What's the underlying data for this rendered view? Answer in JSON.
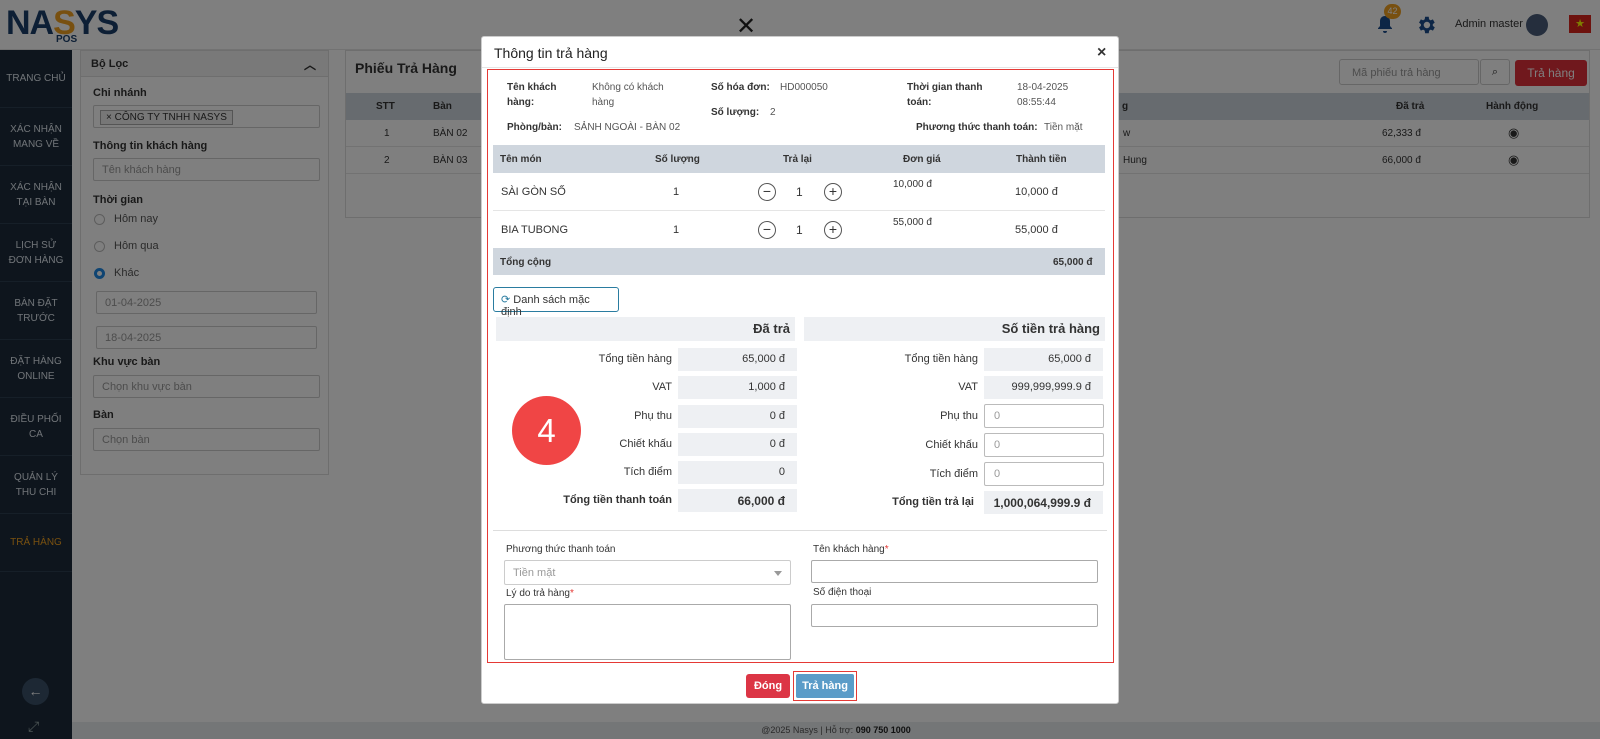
{
  "app": {
    "logo_text_1": "NA",
    "logo_text_2": "S",
    "logo_text_3": "YS",
    "logo_sub": "POS",
    "notification_count": "42",
    "user_name": "Admin master",
    "flag_icon": "vietnam-flag-icon"
  },
  "sidebar": {
    "items": [
      {
        "label": "TRANG CHỦ"
      },
      {
        "label": "XÁC NHẬN MANG VỀ"
      },
      {
        "label": "XÁC NHẬN TẠI BÀN"
      },
      {
        "label": "LỊCH SỬ ĐƠN HÀNG"
      },
      {
        "label": "BÀN ĐẶT TRƯỚC"
      },
      {
        "label": "ĐẶT HÀNG ONLINE"
      },
      {
        "label": "ĐIỀU PHỐI CA"
      },
      {
        "label": "QUẢN LÝ THU CHI"
      },
      {
        "label": "TRẢ HÀNG"
      }
    ]
  },
  "filter": {
    "title": "Bộ Lọc",
    "branch_label": "Chi nhánh",
    "branch_chip": "CÔNG TY TNHH NASYS",
    "customer_label": "Thông tin khách hàng",
    "customer_placeholder": "Tên khách hàng",
    "time_label": "Thời gian",
    "radio_today": "Hôm nay",
    "radio_yesterday": "Hôm qua",
    "radio_other": "Khác",
    "date_from": "01-04-2025",
    "date_to": "18-04-2025",
    "area_label": "Khu vực bàn",
    "area_placeholder": "Chọn khu vực bàn",
    "table_label": "Bàn",
    "table_placeholder": "Chọn bàn"
  },
  "list": {
    "title": "Phiếu Trả Hàng",
    "search_placeholder": "Mã phiếu trả hàng",
    "add_button": "Trả hàng",
    "headers": {
      "stt": "STT",
      "ban": "Bàn",
      "g": "g",
      "da_tra": "Đã trả",
      "hanh_dong": "Hành động"
    },
    "rows": [
      {
        "stt": "1",
        "ban": "BÀN 02",
        "name": "w",
        "da_tra": "62,333 đ"
      },
      {
        "stt": "2",
        "ban": "BÀN 03",
        "name": "Hung",
        "da_tra": "66,000 đ"
      }
    ]
  },
  "modal": {
    "title": "Thông tin trả hàng",
    "info": {
      "customer_label": "Tên khách hàng:",
      "customer_value": "Không có khách hàng",
      "invoice_label": "Số hóa đơn:",
      "invoice_value": "HD000050",
      "time_label": "Thời gian thanh toán:",
      "time_value_1": "18-04-2025",
      "time_value_2": "08:55:44",
      "qty_label": "Số lượng:",
      "qty_value": "2",
      "room_label": "Phòng/bàn:",
      "room_value": "SẢNH NGOÀI - BÀN 02",
      "payment_label": "Phương thức thanh toán:",
      "payment_value": "Tiền mặt"
    },
    "items_headers": {
      "name": "Tên món",
      "qty": "Số lượng",
      "return": "Trả lại",
      "price": "Đơn giá",
      "total": "Thành tiền"
    },
    "items": [
      {
        "name": "SÀI GÒN SỐ",
        "qty": "1",
        "return_qty": "1",
        "price": "10,000 đ",
        "total": "10,000 đ"
      },
      {
        "name": "BIA TUBONG",
        "qty": "1",
        "return_qty": "1",
        "price": "55,000 đ",
        "total": "55,000 đ"
      }
    ],
    "total_label": "Tổng cộng",
    "total_value": "65,000 đ",
    "default_list_button": "Danh sách mặc định",
    "paid": {
      "title": "Đã trả",
      "rows": [
        {
          "label": "Tổng tiền hàng",
          "value": "65,000 đ"
        },
        {
          "label": "VAT",
          "value": "1,000 đ"
        },
        {
          "label": "Phụ thu",
          "value": "0 đ"
        },
        {
          "label": "Chiết khấu",
          "value": "0 đ"
        },
        {
          "label": "Tích điểm",
          "value": "0"
        },
        {
          "label": "Tổng tiền thanh toán",
          "value": "66,000 đ"
        }
      ]
    },
    "refund": {
      "title": "Số tiền trả hàng",
      "rows": [
        {
          "label": "Tổng tiền hàng",
          "value": "65,000 đ"
        },
        {
          "label": "VAT",
          "value": "999,999,999.9 đ"
        },
        {
          "label": "Phụ thu",
          "value": "0"
        },
        {
          "label": "Chiết khấu",
          "value": "0"
        },
        {
          "label": "Tích điểm",
          "value": "0"
        },
        {
          "label": "Tổng tiền trả lại",
          "value": "1,000,064,999.9 đ"
        }
      ]
    },
    "step_number": "4",
    "form": {
      "payment_method_label": "Phương thức thanh toán",
      "payment_method_value": "Tiền mặt",
      "reason_label": "Lý do trả hàng",
      "customer_name_label": "Tên khách hàng",
      "phone_label": "Số điện thoại",
      "required_mark": "*"
    },
    "close_button": "Đóng",
    "return_button": "Trả hàng"
  },
  "footer": {
    "text": "@2025 Nasys | Hỗ trợ:",
    "phone": "090 750 1000"
  }
}
